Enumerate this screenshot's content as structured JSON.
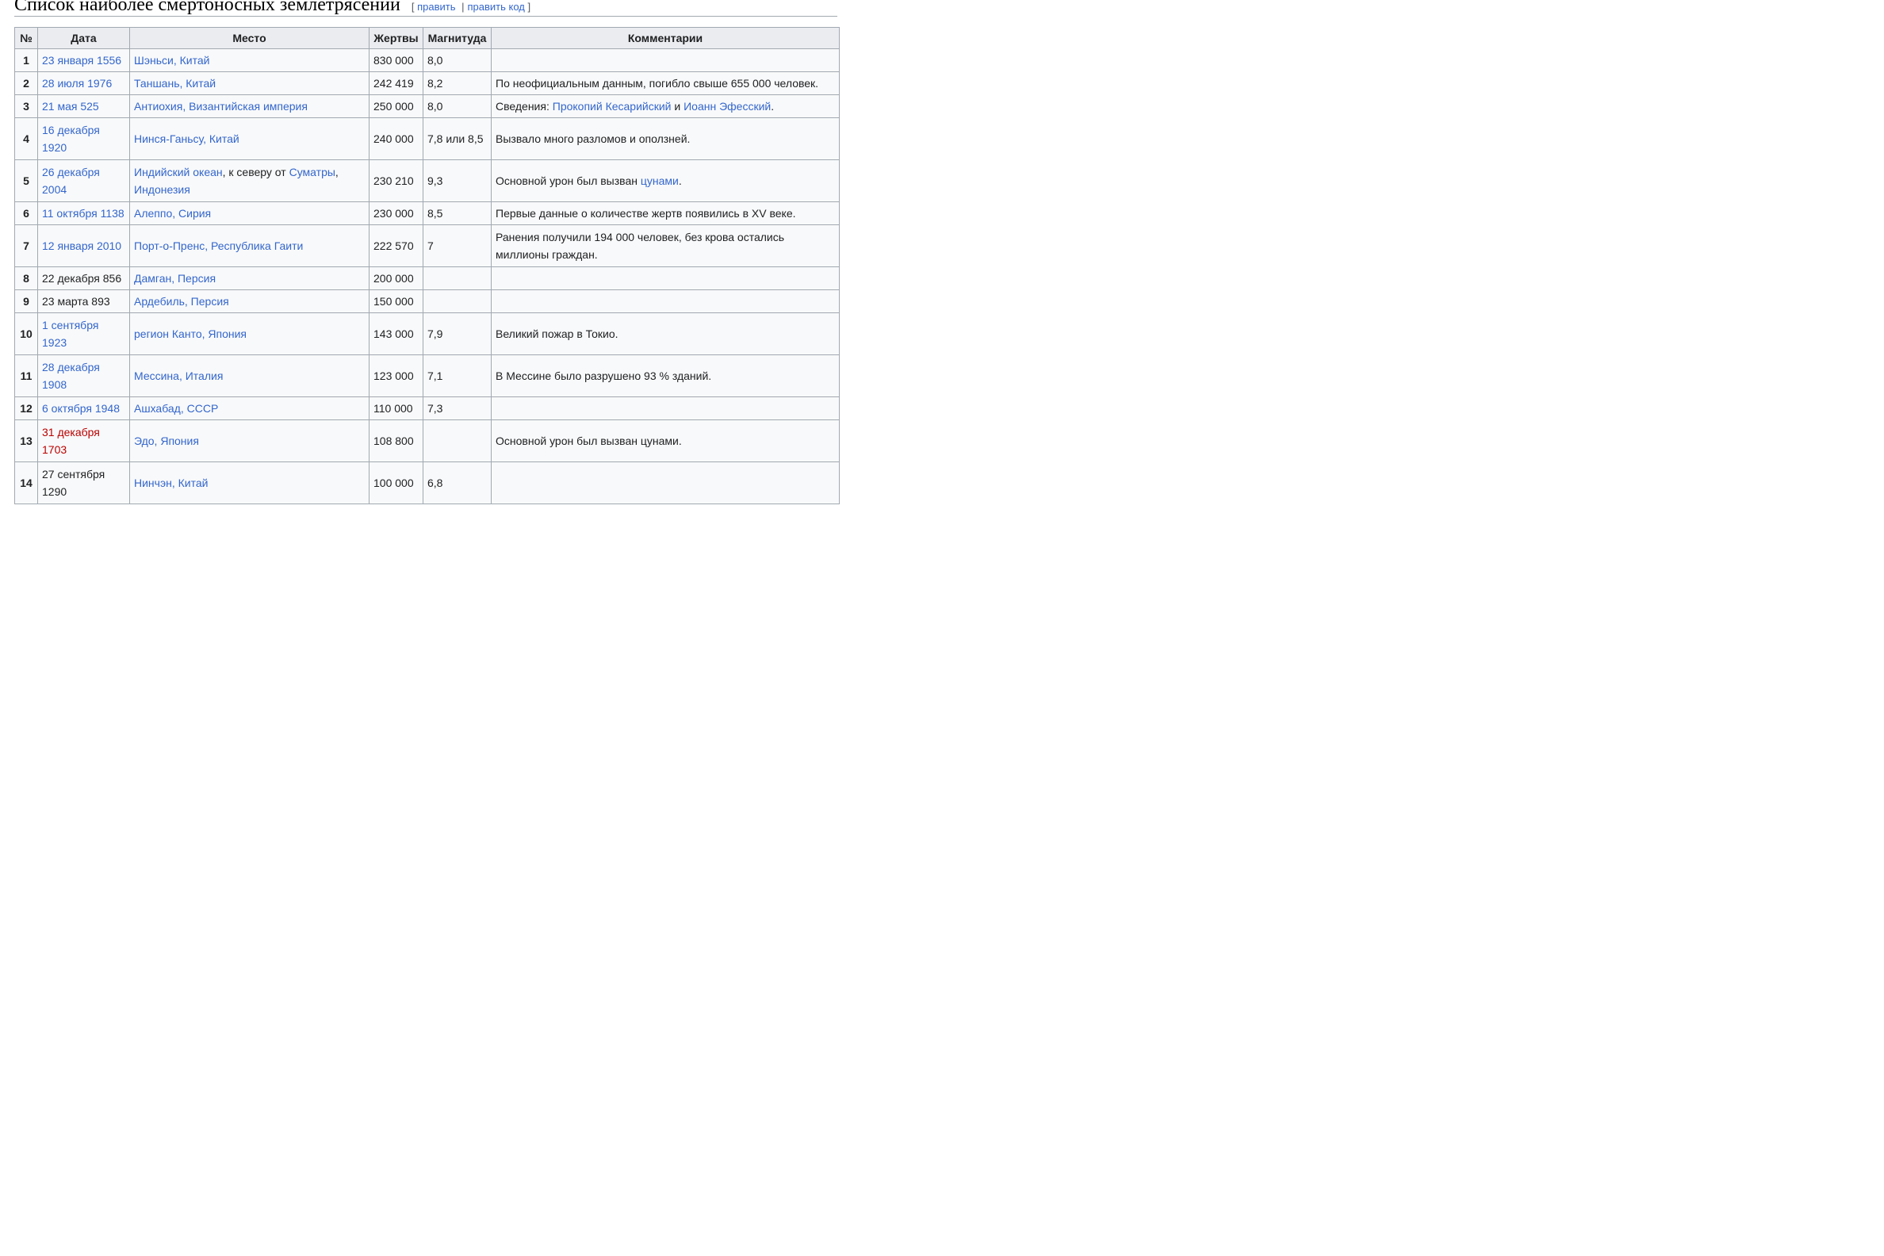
{
  "section": {
    "title": "Список наиболее смертоносных землетрясений",
    "edit_open": "[",
    "edit_label": "править",
    "edit_sep": "|",
    "edit_code_label": "править код",
    "edit_close": "]"
  },
  "table": {
    "headers": [
      "№",
      "Дата",
      "Место",
      "Жертвы",
      "Магнитуда",
      "Комментарии"
    ],
    "rows": [
      {
        "num": "1",
        "date": "23 января 1556",
        "place": "Шэньси, Китай",
        "deaths": "830 000",
        "mag": "8,0",
        "comment": ""
      },
      {
        "num": "2",
        "date": "28 июля 1976",
        "place": "Таншань, Китай",
        "deaths": "242 419",
        "mag": "8,2",
        "comment": "По неофициальным данным, погибло свыше 655 000 человек."
      },
      {
        "num": "3",
        "date": "21 мая 525",
        "place": "Антиохия, Византийская империя",
        "deaths": "250 000",
        "mag": "8,0",
        "comment_prefix": "Сведения: ",
        "comment_link1": "Прокопий Кесарийский",
        "comment_mid": " и ",
        "comment_link2": "Иоанн Эфесский",
        "comment_suffix": "."
      },
      {
        "num": "4",
        "date": "16 декабря 1920",
        "place": "Нинся-Ганьсу, Китай",
        "deaths": "240 000",
        "mag": "7,8 или 8,5",
        "comment": "Вызвало много разломов и оползней."
      },
      {
        "num": "5",
        "date": "26 декабря 2004",
        "place_link1": "Индийский океан",
        "place_mid": ", к северу от ",
        "place_link2": "Суматры",
        "place_sep": ", ",
        "place_link3": "Индонезия",
        "deaths": "230 210",
        "mag": "9,3",
        "comment_prefix": "Основной урон был вызван ",
        "comment_link1": "цунами",
        "comment_suffix": "."
      },
      {
        "num": "6",
        "date": "11 октября 1138",
        "place": "Алеппо, Сирия",
        "deaths": "230 000",
        "mag": "8,5",
        "comment": "Первые данные о количестве жертв появились в XV веке."
      },
      {
        "num": "7",
        "date": "12 января 2010",
        "place": "Порт-о-Пренс, Республика Гаити",
        "deaths": "222 570",
        "mag": "7",
        "comment": "Ранения получили 194 000 человек, без крова остались миллионы граждан."
      },
      {
        "num": "8",
        "date": "22 декабря 856",
        "place": "Дамган, Персия",
        "deaths": "200 000",
        "mag": "",
        "comment": ""
      },
      {
        "num": "9",
        "date": "23 марта 893",
        "place": "Ардебиль, Персия",
        "deaths": "150 000",
        "mag": "",
        "comment": ""
      },
      {
        "num": "10",
        "date": "1 сентября 1923",
        "place": "регион Канто, Япония",
        "deaths": "143 000",
        "mag": "7,9",
        "comment": "Великий пожар в Токио."
      },
      {
        "num": "11",
        "date": "28 декабря 1908",
        "place": "Мессина, Италия",
        "deaths": "123 000",
        "mag": "7,1",
        "comment": "В Мессине было разрушено 93 % зданий."
      },
      {
        "num": "12",
        "date": "6 октября 1948",
        "place": "Ашхабад, СССР",
        "deaths": "110 000",
        "mag": "7,3",
        "comment": ""
      },
      {
        "num": "13",
        "date": "31 декабря 1703",
        "place": "Эдо, Япония",
        "deaths": "108 800",
        "mag": "",
        "comment": "Основной урон был вызван цунами."
      },
      {
        "num": "14",
        "date": "27 сентября 1290",
        "place": "Нинчэн, Китай",
        "deaths": "100 000",
        "mag": "6,8",
        "comment": ""
      }
    ]
  },
  "colors": {
    "link": "#3366cc",
    "redlink": "#ba0000",
    "header_bg": "#eaecf0",
    "cell_bg": "#f8f9fa",
    "border": "#a2a9b1"
  }
}
